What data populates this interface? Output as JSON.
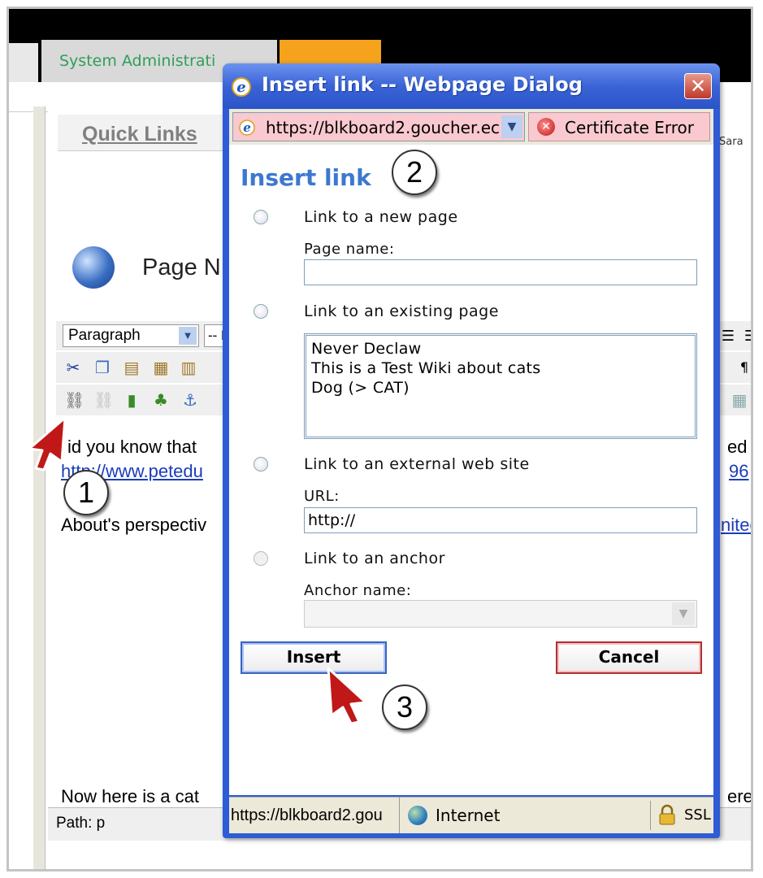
{
  "background": {
    "tabs": {
      "system_admin": "System Administrati",
      "orange_tab": ""
    },
    "quick_links": "Quick Links",
    "user_name_fragment": "Sara",
    "page_title_fragment": "Page N",
    "editor": {
      "format_select": "Paragraph",
      "font_select": "-- F",
      "text_fragment_1": "id you know that",
      "text_fragment_1_right": "ed th",
      "link_fragment_1": "http://www.petedu",
      "link_fragment_1_right": "96",
      "text_fragment_2": "About's perspectiv",
      "link_fragment_2_right": "nited",
      "text_fragment_3": "Now here is a cat",
      "text_fragment_3_right": "ere",
      "path": "Path: p"
    }
  },
  "dialog": {
    "title": "Insert link -- Webpage Dialog",
    "close_glyph": "✕",
    "address": "https://blkboard2.goucher.ec",
    "certificate": "Certificate Error",
    "heading": "Insert link",
    "options": {
      "new_page": "Link to a new page",
      "page_name_label": "Page name:",
      "page_name_value": "",
      "existing_page": "Link to an existing page",
      "existing_pages": [
        "Never Declaw",
        "This is a Test Wiki about cats",
        "Dog (> CAT)"
      ],
      "external": "Link to an external web site",
      "url_label": "URL:",
      "url_value": "http://",
      "anchor": "Link to an anchor",
      "anchor_label": "Anchor name:"
    },
    "insert_button": "Insert",
    "cancel_button": "Cancel",
    "status": {
      "url": "https://blkboard2.gou",
      "zone": "Internet",
      "ssl": "SSL"
    }
  },
  "annotations": {
    "step1": "1",
    "step2": "2",
    "step3": "3"
  },
  "colors": {
    "dialog_frame": "#2e5bd6",
    "heading": "#3c78d0",
    "cert_error_bg": "#f9c9cf",
    "tab_orange": "#f5a21c",
    "tab_text_green": "#2f9e5b"
  }
}
